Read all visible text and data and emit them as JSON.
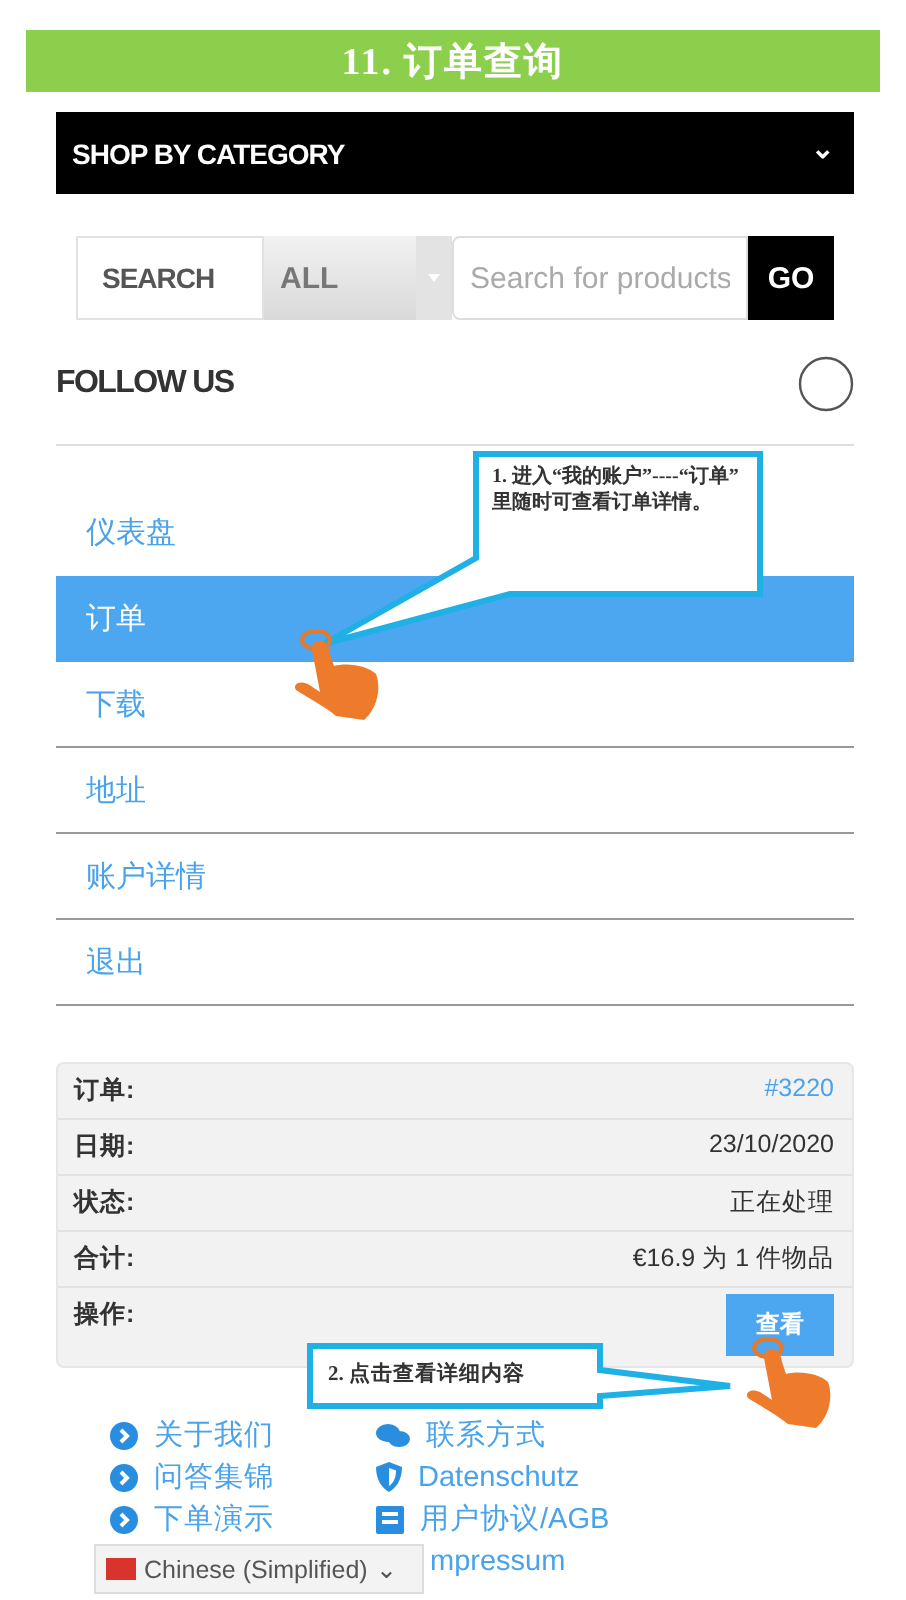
{
  "banner": {
    "title": "11. 订单查询"
  },
  "category_bar": {
    "label": "SHOP BY CATEGORY",
    "caret": "⌄"
  },
  "search": {
    "label": "SEARCH",
    "category": "ALL",
    "placeholder": "Search for products",
    "button": "GO"
  },
  "follow": {
    "label": "FOLLOW US"
  },
  "account_menu": [
    {
      "label": "仪表盘",
      "selected": false
    },
    {
      "label": "订单",
      "selected": true
    },
    {
      "label": "下载",
      "selected": false
    },
    {
      "label": "地址",
      "selected": false
    },
    {
      "label": "账户详情",
      "selected": false
    },
    {
      "label": "退出",
      "selected": false
    }
  ],
  "order": [
    {
      "label": "订单:",
      "value": "#3220",
      "kind": "link"
    },
    {
      "label": "日期:",
      "value": "23/10/2020",
      "kind": "text"
    },
    {
      "label": "状态:",
      "value": "正在处理",
      "kind": "text"
    },
    {
      "label": "合计:",
      "value": "€16.9 为 1 件物品",
      "kind": "text"
    },
    {
      "label": "操作:",
      "value": "查看",
      "kind": "button"
    }
  ],
  "annotations": [
    {
      "text": "1. 进入“我的账户”----“订单” 里随时可查看订单详情。",
      "kind": "down-left"
    },
    {
      "text": "2. 点击查看详细内容",
      "kind": "right"
    }
  ],
  "footer_links": [
    {
      "label": "关于我们"
    },
    {
      "label": "联系方式"
    },
    {
      "label": "问答集锦"
    },
    {
      "label": "Datenschutz"
    },
    {
      "label": "下单演示"
    },
    {
      "label": "用户协议/AGB"
    },
    {
      "label": "mpressum"
    }
  ],
  "language": {
    "label": "Chinese (Simplified)",
    "caret": "⌄"
  }
}
